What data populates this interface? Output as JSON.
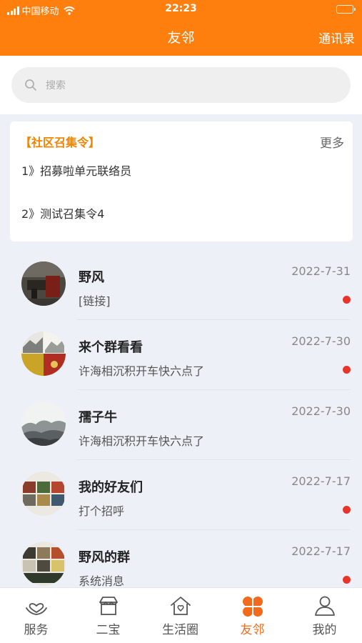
{
  "status_bar": {
    "carrier": "中国移动",
    "time": "22:23"
  },
  "nav": {
    "title": "友邻",
    "right_label": "通讯录"
  },
  "search": {
    "placeholder": "搜索"
  },
  "notice": {
    "title": "【社区召集令】",
    "more_label": "更多",
    "items": [
      "1》招募啦单元联络员",
      "2》测试召集令4"
    ]
  },
  "conversations": [
    {
      "name": "野风",
      "message": "[链接]",
      "date": "2022-7-31",
      "unread": true
    },
    {
      "name": "来个群看看",
      "message": "许海相沉积开车快六点了",
      "date": "2022-7-30",
      "unread": true
    },
    {
      "name": "孺子牛",
      "message": "许海相沉积开车快六点了",
      "date": "2022-7-30",
      "unread": false
    },
    {
      "name": "我的好友们",
      "message": "打个招呼",
      "date": "2022-7-17",
      "unread": true
    },
    {
      "name": "野风的群",
      "message": "系统消息",
      "date": "2022-7-17",
      "unread": true
    }
  ],
  "tabs": [
    {
      "label": "服务",
      "icon": "heart-hand-icon",
      "active": false
    },
    {
      "label": "二宝",
      "icon": "shop-icon",
      "active": false
    },
    {
      "label": "生活圈",
      "icon": "home-heart-icon",
      "active": false
    },
    {
      "label": "友邻",
      "icon": "clover-icon",
      "active": true
    },
    {
      "label": "我的",
      "icon": "person-icon",
      "active": false
    }
  ],
  "colors": {
    "accent": "#ff7f0e",
    "active_tab": "#f26b1d",
    "unread_dot": "#e8352b"
  }
}
